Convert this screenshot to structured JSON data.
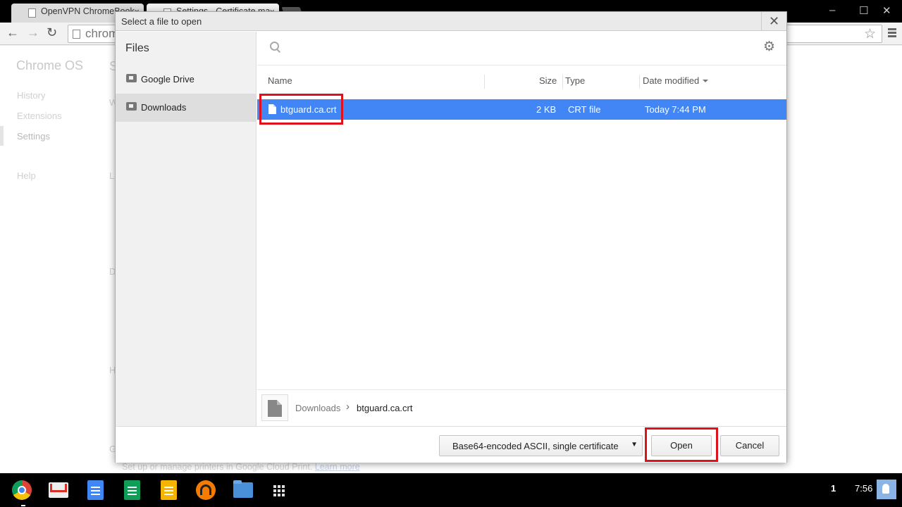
{
  "browser": {
    "tabs": [
      {
        "title": "OpenVPN ChromeBook",
        "close": "×"
      },
      {
        "title": "Settings - Certificate ma",
        "close": "×"
      }
    ],
    "window_controls": {
      "minimize": "–",
      "maximize": "☐",
      "close": "✕"
    },
    "nav": {
      "back": "←",
      "forward": "→",
      "reload": "↻"
    },
    "omnibox": {
      "text": "chrom",
      "star": "☆"
    }
  },
  "background_page": {
    "brand": "Chrome OS",
    "nav_items": [
      "History",
      "Extensions",
      "Settings",
      "Help"
    ],
    "active_nav": "Settings",
    "section_letters": [
      "S",
      "W",
      "L",
      "D",
      "H",
      "G"
    ],
    "footer_text": "Set up or manage printers in Google Cloud Print.",
    "footer_link": "Learn more"
  },
  "dialog": {
    "title": "Select a file to open",
    "close": "✕",
    "sidebar": {
      "heading": "Files",
      "items": [
        {
          "label": "Google Drive",
          "icon": "drive-folder-icon",
          "selected": false
        },
        {
          "label": "Downloads",
          "icon": "downloads-folder-icon",
          "selected": true
        }
      ]
    },
    "search": {
      "placeholder": "",
      "settings_icon": "⚙"
    },
    "columns": {
      "name": "Name",
      "size": "Size",
      "type": "Type",
      "date": "Date modified"
    },
    "files": [
      {
        "name": "btguard.ca.crt",
        "size": "2 KB",
        "type": "CRT file",
        "date": "Today 7:44 PM",
        "selected": true
      }
    ],
    "breadcrumb": {
      "root": "Downloads",
      "separator": "›",
      "current": "btguard.ca.crt"
    },
    "file_type_select": {
      "value": "Base64-encoded ASCII, single certificate",
      "arrow": "▼"
    },
    "buttons": {
      "open": "Open",
      "cancel": "Cancel"
    },
    "highlight_color": "#e0101c",
    "selection_color": "#4285f4"
  },
  "shelf": {
    "apps": [
      "Chrome",
      "Gmail",
      "Docs",
      "Sheets",
      "Slides",
      "Play Music",
      "Files",
      "App launcher"
    ],
    "notification_count": "1",
    "time": "7:56"
  }
}
